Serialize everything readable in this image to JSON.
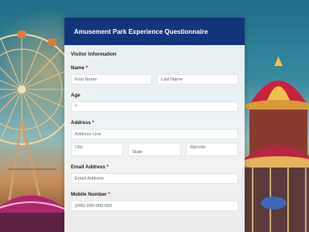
{
  "form": {
    "title": "Amusement Park Experience Questionnaire",
    "section_title": "Visitor Information",
    "name": {
      "label": "Name",
      "required": "*",
      "first_placeholder": "First Name",
      "last_placeholder": "Last Name"
    },
    "age": {
      "label": "Age",
      "select_value": "^"
    },
    "address": {
      "label": "Address",
      "required": "*",
      "line_placeholder": "Address Line",
      "city_placeholder": "City",
      "state_placeholder": "State",
      "zip_placeholder": "Zipcode"
    },
    "email": {
      "label": "Email Address",
      "required": "*",
      "placeholder": "Email Address"
    },
    "mobile": {
      "label": "Mobile Number",
      "required": "*",
      "placeholder": "(000) 000-000-000"
    }
  },
  "colors": {
    "header_bg": "#12357a",
    "required_mark": "#d0021b"
  }
}
